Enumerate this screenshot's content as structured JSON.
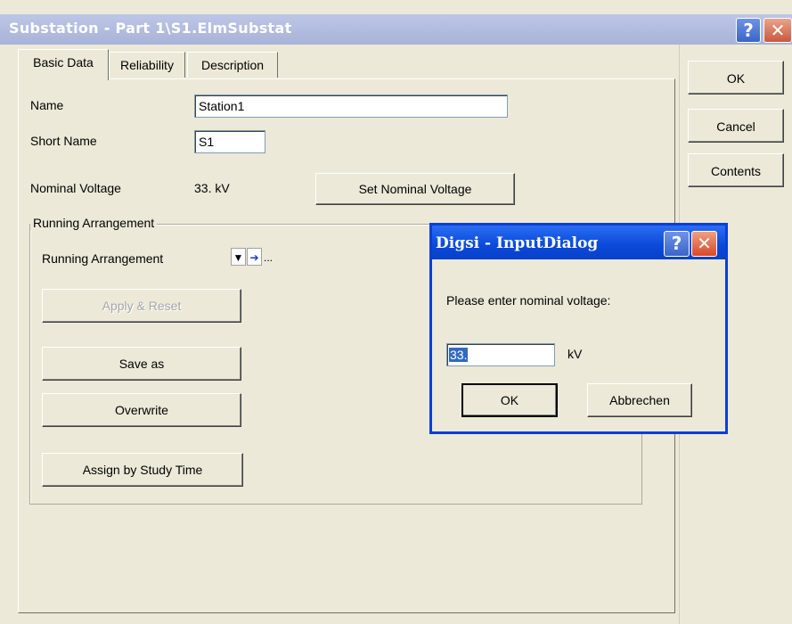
{
  "window": {
    "title": "Substation - Part 1\\S1.ElmSubstat",
    "help_glyph": "?",
    "close_glyph": "✕"
  },
  "tabs": [
    {
      "label": "Basic Data",
      "active": true
    },
    {
      "label": "Reliability",
      "active": false
    },
    {
      "label": "Description",
      "active": false
    }
  ],
  "basic": {
    "name_label": "Name",
    "name_value": "Station1",
    "short_name_label": "Short Name",
    "short_name_value": "S1",
    "nominal_voltage_label": "Nominal Voltage",
    "nominal_voltage_value": "33. kV",
    "set_nominal_button": "Set Nominal Voltage"
  },
  "running": {
    "group_title": "Running Arrangement",
    "label": "Running Arrangement",
    "dropdown_glyph": "▼",
    "arrow_glyph": "➔",
    "ellipsis": "...",
    "apply_reset": "Apply & Reset",
    "save_as": "Save as",
    "overwrite": "Overwrite",
    "assign": "Assign by Study Time"
  },
  "side_buttons": {
    "ok": "OK",
    "cancel": "Cancel",
    "contents": "Contents"
  },
  "input_dialog": {
    "title": "Digsi - InputDialog",
    "prompt": "Please enter nominal voltage:",
    "value": "33.",
    "unit": "kV",
    "ok": "OK",
    "cancel": "Abbrechen"
  },
  "colors": {
    "dialog_frame": "#0a3fd4",
    "title_inactive": "#a8b3d8",
    "window_bg": "#ece9d8"
  }
}
